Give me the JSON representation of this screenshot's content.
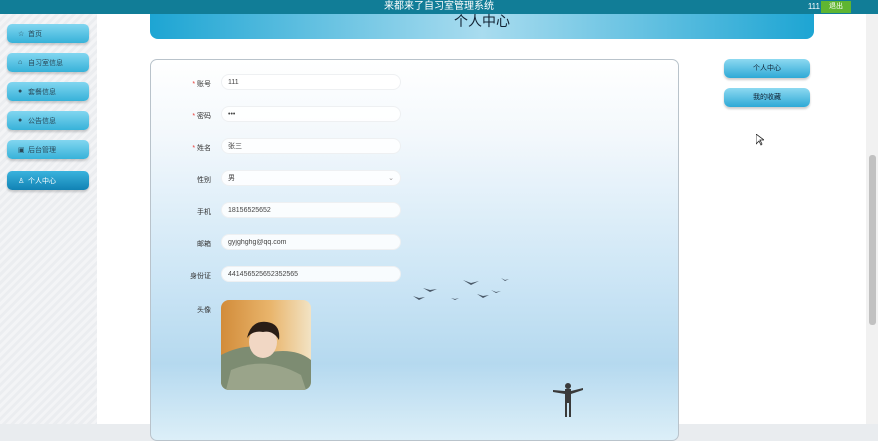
{
  "header": {
    "app_title": "来都来了自习室管理系统",
    "username": "111",
    "logout_label": "退出"
  },
  "sidebar": {
    "items": [
      {
        "label": "首页",
        "icon": "star-icon",
        "active": false
      },
      {
        "label": "自习室信息",
        "icon": "building-icon",
        "active": false
      },
      {
        "label": "套餐信息",
        "icon": "circle-icon",
        "active": false
      },
      {
        "label": "公告信息",
        "icon": "help-circle-icon",
        "active": false
      },
      {
        "label": "后台管理",
        "icon": "calendar-icon",
        "active": false
      },
      {
        "label": "个人中心",
        "icon": "user-icon",
        "active": true
      }
    ]
  },
  "page": {
    "title": "个人中心"
  },
  "form": {
    "account": {
      "label": "账号",
      "required": true,
      "value": "111"
    },
    "password": {
      "label": "密码",
      "required": true,
      "value": "•••"
    },
    "name": {
      "label": "姓名",
      "required": true,
      "value": "张三"
    },
    "gender": {
      "label": "性别",
      "required": false,
      "value": "男"
    },
    "phone": {
      "label": "手机",
      "required": false,
      "value": "18156525652"
    },
    "email": {
      "label": "邮箱",
      "required": false,
      "value": "gyjghghg@qq.com"
    },
    "id_card": {
      "label": "身份证",
      "required": false,
      "value": "441456525652352565"
    },
    "avatar": {
      "label": "头像"
    }
  },
  "right_menu": {
    "items": [
      {
        "label": "个人中心"
      },
      {
        "label": "我的收藏"
      }
    ]
  },
  "colors": {
    "topbar": "#117d97",
    "logout": "#5fb531",
    "accent": "#1da5d3",
    "required": "#e53935"
  }
}
